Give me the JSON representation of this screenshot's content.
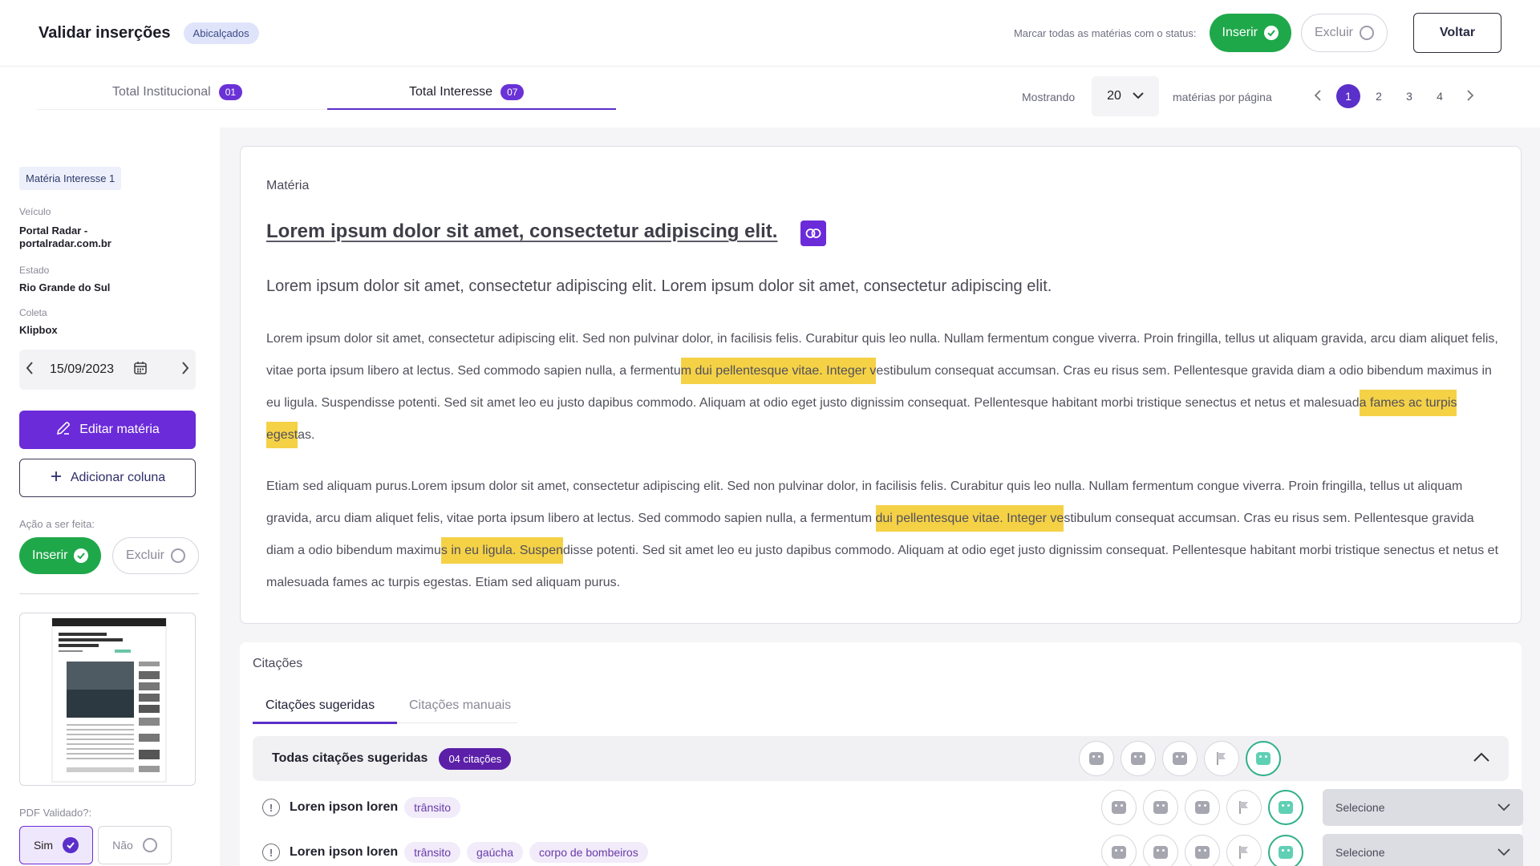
{
  "header": {
    "title": "Validar inserções",
    "badge": "Abicalçados",
    "mark_label": "Marcar todas as matérias com o status:",
    "insert_label": "Inserir",
    "exclude_label": "Excluir",
    "back_label": "Voltar"
  },
  "tabs": [
    {
      "label": "Total Institucional",
      "count": "01"
    },
    {
      "label": "Total Interesse",
      "count": "07"
    }
  ],
  "pagination": {
    "showing_label": "Mostrando",
    "per_page_value": "20",
    "per_page_label": "matérias por página",
    "pages": [
      "1",
      "2",
      "3",
      "4"
    ],
    "current_page": "1"
  },
  "sidebar": {
    "chip": "Matéria Interesse 1",
    "vehicle_label": "Veículo",
    "vehicle_value": "Portal Radar - portalradar.com.br",
    "state_label": "Estado",
    "state_value": "Rio Grande do Sul",
    "collection_label": "Coleta",
    "collection_value": "Klipbox",
    "date": "15/09/2023",
    "edit_label": "Editar matéria",
    "add_column_label": "Adicionar coluna",
    "action_label": "Ação a ser feita:",
    "insert_label": "Inserir",
    "exclude_label": "Excluir",
    "pdf_label": "PDF Validado?:",
    "pdf_yes": "Sim",
    "pdf_no": "Não"
  },
  "article": {
    "section_label": "Matéria",
    "title": "Lorem ipsum dolor sit amet, consectetur adipiscing elit.",
    "subtitle": "Lorem ipsum dolor sit amet, consectetur adipiscing elit. Lorem ipsum dolor sit amet, consectetur adipiscing elit.",
    "p1": {
      "t1": "Lorem ipsum dolor sit amet, consectetur adipiscing elit. Sed non pulvinar dolor, in facilisis felis. Curabitur quis leo nulla. Nullam fermentum congue viverra. Proin fringilla, tellus ut aliquam gravida, arcu diam aliquet felis, vitae porta ipsum libero at lectus. Sed commodo sapien nulla, a fermentu",
      "h1": "m dui pellentesque vitae. Integer v",
      "t2": "estibulum consequat accumsan. Cras eu risus sem. Pellentesque gravida diam a odio bibendum maximus in eu ligula. Suspendisse potenti. Sed sit amet leo eu justo dapibus commodo. Aliquam at odio eget justo dignissim consequat. Pellentesque habitant morbi tristique senectus et netus et malesuad",
      "h2": "a fames ac turpis egest",
      "t3": "as."
    },
    "p2": {
      "t1": "Etiam sed aliquam purus.Lorem ipsum dolor sit amet, consectetur adipiscing elit. Sed non pulvinar dolor, in facilisis felis. Curabitur quis leo nulla. Nullam fermentum congue viverra. Proin fringilla, tellus ut aliquam gravida, arcu diam aliquet felis, vitae porta ipsum libero at lectus. Sed commodo sapien nulla, a fermentum ",
      "h1": "dui pellentesque vitae. Integer ve",
      "t2": "stibulum consequat accumsan. Cras eu risus sem. Pellentesque gravida diam a odio bibendum maximu",
      "h2": "s in eu ligula. Suspen",
      "t3": "disse potenti. Sed sit amet leo eu justo dapibus commodo. Aliquam at odio eget justo dignissim consequat. Pellentesque habitant morbi tristique senectus et netus et malesuada fames ac turpis egestas. Etiam sed aliquam purus."
    }
  },
  "citations": {
    "section_label": "Citações",
    "tab_suggested": "Citações sugeridas",
    "tab_manual": "Citações manuais",
    "group_title": "Todas citações sugeridas",
    "group_count": "04 citações",
    "rows": [
      {
        "title": "Loren ipson loren",
        "tags": [
          "trânsito"
        ],
        "select": "Selecione"
      },
      {
        "title": "Loren ipson loren",
        "tags": [
          "trânsito",
          "gaúcha",
          "corpo de bombeiros"
        ],
        "select": "Selecione"
      }
    ]
  },
  "colors": {
    "accent": "#5b2fc9",
    "green": "#1fa84a",
    "highlight": "#f5d146"
  }
}
